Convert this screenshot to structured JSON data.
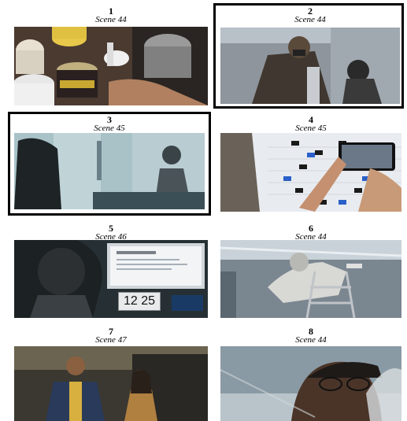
{
  "panels": [
    {
      "number": "1",
      "scene": "Scene 44",
      "description_icon": "paint-cans-photo",
      "highlighted": false
    },
    {
      "number": "2",
      "scene": "Scene 44",
      "description_icon": "worker-with-respirator-photo",
      "highlighted": true
    },
    {
      "number": "3",
      "scene": "Scene 45",
      "description_icon": "person-behind-frosted-glass-photo",
      "highlighted": true
    },
    {
      "number": "4",
      "scene": "Scene 45",
      "description_icon": "phone-photographing-schedule-board-photo",
      "highlighted": false
    },
    {
      "number": "5",
      "scene": "Scene 46",
      "description_icon": "monitor-and-clock-photo",
      "highlighted": false,
      "clock_text": "12 25"
    },
    {
      "number": "6",
      "scene": "Scene 44",
      "description_icon": "spray-painting-worker-photo",
      "highlighted": false
    },
    {
      "number": "7",
      "scene": "Scene 47",
      "description_icon": "two-people-in-garage-photo",
      "highlighted": false
    },
    {
      "number": "8",
      "scene": "Scene 44",
      "description_icon": "person-with-glasses-photo",
      "highlighted": false
    }
  ]
}
